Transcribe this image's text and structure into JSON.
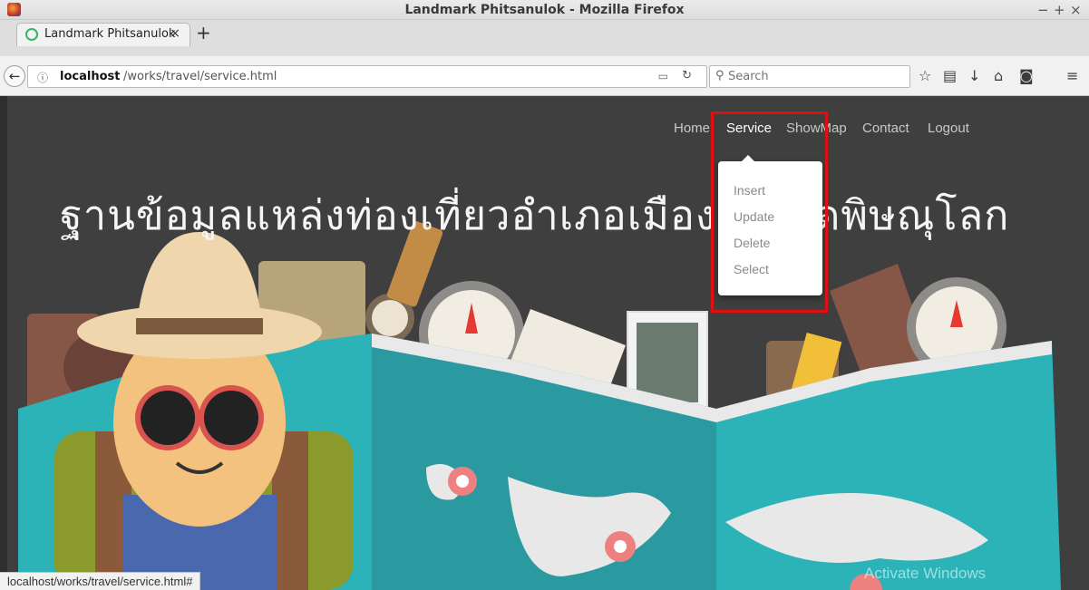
{
  "window": {
    "title": "Landmark Phitsanulok - Mozilla Firefox",
    "controls": [
      "−",
      "+",
      "×"
    ]
  },
  "tabs": [
    {
      "label": "Landmark Phitsanulok",
      "close": "×"
    }
  ],
  "newtab_label": "+",
  "navbar": {
    "back_glyph": "←",
    "url_host": "localhost",
    "url_path": "/works/travel/service.html",
    "search_placeholder": "Search",
    "icons": [
      "star-icon",
      "reading-list-icon",
      "download-icon",
      "home-icon",
      "pocket-icon",
      "menu-icon"
    ]
  },
  "site_nav": {
    "items": [
      "Home",
      "Service",
      "ShowMap",
      "Contact",
      "Logout"
    ],
    "active": "Service"
  },
  "headline": "ฐานข้อมูลแหล่งท่องเที่ยวอำเภอเมืองจังหวัดพิษณุโลก",
  "dropdown": {
    "items": [
      "Insert",
      "Update",
      "Delete",
      "Select"
    ]
  },
  "status_url": "localhost/works/travel/service.html#",
  "watermark": "Activate Windows",
  "colors": {
    "page_bg": "#3f3f3f",
    "map_teal": "#2bb3b8",
    "highlight_red": "#e01010"
  }
}
